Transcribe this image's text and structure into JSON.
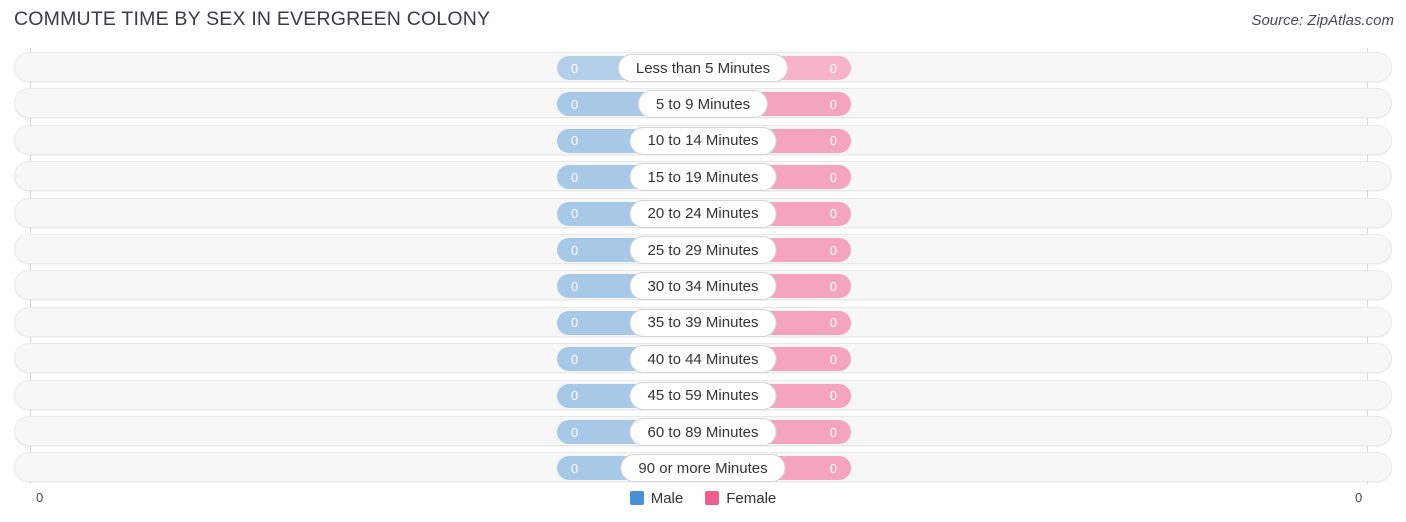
{
  "header": {
    "title": "COMMUTE TIME BY SEX IN EVERGREEN COLONY",
    "source": "Source: ZipAtlas.com"
  },
  "legend": {
    "male_label": "Male",
    "female_label": "Female"
  },
  "axis": {
    "left_tick": "0",
    "right_tick": "0"
  },
  "colors": {
    "male": "#4a90d9",
    "female": "#ef5f8c",
    "male_bar": "#a8c8e8",
    "female_bar": "#f4a4bf",
    "male_bar_first": "#b4cfea",
    "female_bar_first": "#f7b3c9",
    "track": "#f7f7f8",
    "gridline": "#d8d8dc",
    "title": "#3b3b47"
  },
  "chart_data": {
    "type": "bar",
    "title": "COMMUTE TIME BY SEX IN EVERGREEN COLONY",
    "subtitle": "",
    "orientation": "horizontal",
    "style": "diverging-bidirectional",
    "xlabel": "",
    "ylabel": "",
    "xlim": [
      0,
      0
    ],
    "grid": true,
    "legend_position": "bottom-center",
    "categories": [
      "Less than 5 Minutes",
      "5 to 9 Minutes",
      "10 to 14 Minutes",
      "15 to 19 Minutes",
      "20 to 24 Minutes",
      "25 to 29 Minutes",
      "30 to 34 Minutes",
      "35 to 39 Minutes",
      "40 to 44 Minutes",
      "45 to 59 Minutes",
      "60 to 89 Minutes",
      "90 or more Minutes"
    ],
    "series": [
      {
        "name": "Male",
        "color": "#4a90d9",
        "direction": "left",
        "values": [
          0,
          0,
          0,
          0,
          0,
          0,
          0,
          0,
          0,
          0,
          0,
          0
        ],
        "labels": [
          "0",
          "0",
          "0",
          "0",
          "0",
          "0",
          "0",
          "0",
          "0",
          "0",
          "0",
          "0"
        ]
      },
      {
        "name": "Female",
        "color": "#ef5f8c",
        "direction": "right",
        "values": [
          0,
          0,
          0,
          0,
          0,
          0,
          0,
          0,
          0,
          0,
          0,
          0
        ],
        "labels": [
          "0",
          "0",
          "0",
          "0",
          "0",
          "0",
          "0",
          "0",
          "0",
          "0",
          "0",
          "0"
        ]
      }
    ],
    "axis_ticks": [
      "0",
      "0"
    ]
  }
}
